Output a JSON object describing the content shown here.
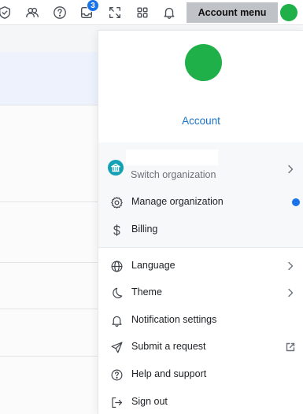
{
  "topbar": {
    "icons": [
      {
        "name": "shield-check-icon"
      },
      {
        "name": "people-icon"
      },
      {
        "name": "help-circle-icon"
      },
      {
        "name": "inbox-icon",
        "badge": "3"
      },
      {
        "name": "expand-icon"
      },
      {
        "name": "apps-grid-icon"
      },
      {
        "name": "bell-icon"
      }
    ],
    "account_menu_label": "Account menu",
    "avatar_color": "#1fb04a"
  },
  "menu": {
    "avatar_color": "#1fb04a",
    "account_link": "Account",
    "switch_organization": "Switch organization",
    "organization_icon_color": "#14a1b5",
    "manage_organization": "Manage organization",
    "manage_organization_dot_color": "#1a73e8",
    "billing": "Billing",
    "language": "Language",
    "theme": "Theme",
    "notification_settings": "Notification settings",
    "submit_request": "Submit a request",
    "help_support": "Help and support",
    "sign_out": "Sign out"
  },
  "colors": {
    "accent": "#1a73e8",
    "link": "#1a73c7",
    "account_button_bg": "#bfc2c6"
  }
}
